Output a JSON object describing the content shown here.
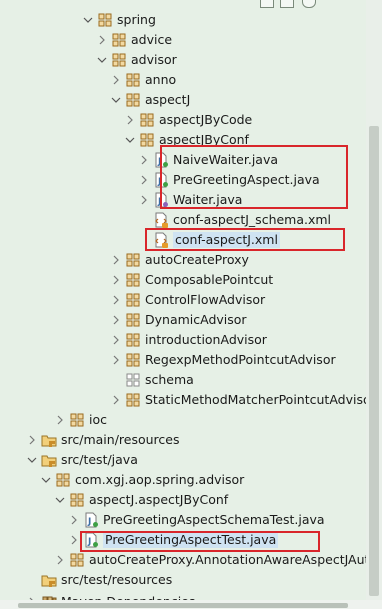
{
  "tree": {
    "rows": [
      {
        "label": "spring",
        "icon": "package",
        "state": "expanded"
      },
      {
        "label": "advice",
        "icon": "package",
        "state": "collapsed"
      },
      {
        "label": "advisor",
        "icon": "package",
        "state": "expanded"
      },
      {
        "label": "anno",
        "icon": "package",
        "state": "collapsed"
      },
      {
        "label": "aspectJ",
        "icon": "package",
        "state": "expanded"
      },
      {
        "label": "aspectJByCode",
        "icon": "package",
        "state": "collapsed"
      },
      {
        "label": "aspectJByConf",
        "icon": "package",
        "state": "expanded"
      },
      {
        "label": "NaiveWaiter.java",
        "icon": "java-class",
        "state": "collapsed"
      },
      {
        "label": "PreGreetingAspect.java",
        "icon": "java-class",
        "state": "collapsed"
      },
      {
        "label": "Waiter.java",
        "icon": "java-interface",
        "state": "collapsed"
      },
      {
        "label": "conf-aspectJ_schema.xml",
        "icon": "xml-file",
        "state": "leaf"
      },
      {
        "label": "conf-aspectJ.xml",
        "icon": "xml-file",
        "state": "leaf"
      },
      {
        "label": "autoCreateProxy",
        "icon": "package",
        "state": "collapsed"
      },
      {
        "label": "ComposablePointcut",
        "icon": "package",
        "state": "collapsed"
      },
      {
        "label": "ControlFlowAdvisor",
        "icon": "package",
        "state": "collapsed"
      },
      {
        "label": "DynamicAdvisor",
        "icon": "package",
        "state": "collapsed"
      },
      {
        "label": "introductionAdvisor",
        "icon": "package",
        "state": "collapsed"
      },
      {
        "label": "RegexpMethodPointcutAdvisor",
        "icon": "package",
        "state": "collapsed"
      },
      {
        "label": "schema",
        "icon": "package-empty",
        "state": "leaf"
      },
      {
        "label": "StaticMethodMatcherPointcutAdviso",
        "icon": "package",
        "state": "collapsed"
      },
      {
        "label": "ioc",
        "icon": "package",
        "state": "collapsed"
      },
      {
        "label": "src/main/resources",
        "icon": "source-folder",
        "state": "collapsed"
      },
      {
        "label": "src/test/java",
        "icon": "source-folder",
        "state": "expanded"
      },
      {
        "label": "com.xgj.aop.spring.advisor",
        "icon": "package",
        "state": "expanded"
      },
      {
        "label": "aspectJ.aspectJByConf",
        "icon": "package",
        "state": "expanded"
      },
      {
        "label": "PreGreetingAspectSchemaTest.java",
        "icon": "java-class",
        "state": "collapsed"
      },
      {
        "label": "PreGreetingAspectTest.java",
        "icon": "java-class",
        "state": "collapsed"
      },
      {
        "label": "autoCreateProxy.AnnotationAwareAspectJAuto",
        "icon": "package",
        "state": "collapsed"
      },
      {
        "label": "src/test/resources",
        "icon": "source-folder",
        "state": "leaf"
      },
      {
        "label": "Maven Dependencies",
        "icon": "library",
        "state": "collapsed"
      }
    ]
  },
  "colors": {
    "background": "#e6f0e6",
    "selection": "#cfe3f2",
    "highlight_box": "#d9262b"
  }
}
